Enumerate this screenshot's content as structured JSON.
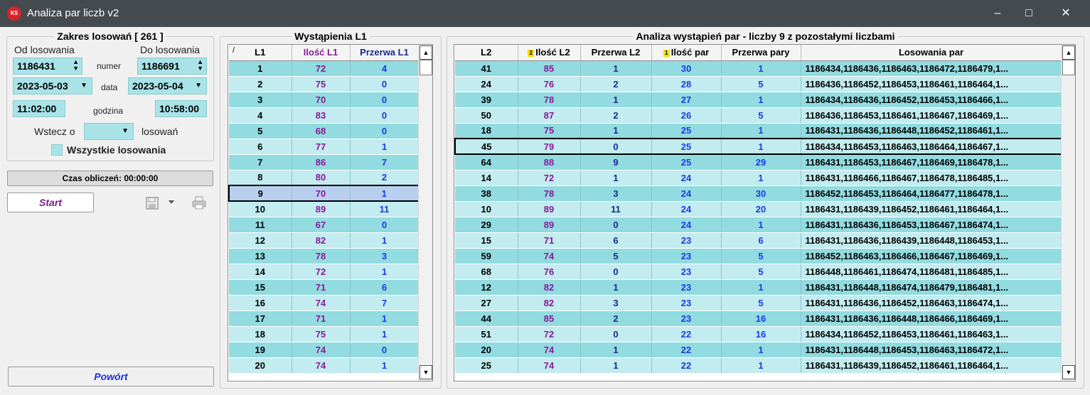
{
  "window": {
    "title": "Analiza par liczb v2",
    "app_icon": "K5"
  },
  "range": {
    "legend": "Zakres losowań  [ 261 ]",
    "from_label": "Od losowania",
    "to_label": "Do losowania",
    "from_number": "1186431",
    "to_number": "1186691",
    "number_label": "numer",
    "from_date": "2023-05-03",
    "to_date": "2023-05-04",
    "date_label": "data",
    "from_time": "11:02:00",
    "to_time": "10:58:00",
    "time_label": "godzina",
    "back_label": "Wstecz o",
    "back_value": "",
    "back_suffix": "losowań",
    "all_draws_label": "Wszystkie losowania"
  },
  "calc_time": "Czas obliczeń: 00:00:00",
  "start_label": "Start",
  "back_button": "Powórt",
  "l1": {
    "legend": "Wystąpienia L1",
    "headers": [
      "/",
      "L1",
      "Ilość L1",
      "Przerwa L1"
    ],
    "selected_index": 8,
    "rows": [
      [
        "1",
        "72",
        "4"
      ],
      [
        "2",
        "75",
        "0"
      ],
      [
        "3",
        "70",
        "0"
      ],
      [
        "4",
        "83",
        "0"
      ],
      [
        "5",
        "68",
        "0"
      ],
      [
        "6",
        "77",
        "1"
      ],
      [
        "7",
        "86",
        "7"
      ],
      [
        "8",
        "80",
        "2"
      ],
      [
        "9",
        "70",
        "1"
      ],
      [
        "10",
        "89",
        "11"
      ],
      [
        "11",
        "67",
        "0"
      ],
      [
        "12",
        "82",
        "1"
      ],
      [
        "13",
        "78",
        "3"
      ],
      [
        "14",
        "72",
        "1"
      ],
      [
        "15",
        "71",
        "6"
      ],
      [
        "16",
        "74",
        "7"
      ],
      [
        "17",
        "71",
        "1"
      ],
      [
        "18",
        "75",
        "1"
      ],
      [
        "19",
        "74",
        "0"
      ],
      [
        "20",
        "74",
        "1"
      ]
    ]
  },
  "pairs": {
    "legend": "Analiza wystąpień par - liczby 9 z pozostałymi liczbami",
    "headers": [
      "L2",
      "Ilość L2",
      "Przerwa L2",
      "Ilość par",
      "Przerwa pary",
      "Losowania par"
    ],
    "sort_badges": {
      "Ilość L2": "2",
      "Ilość par": "1"
    },
    "selected_index": 5,
    "rows": [
      [
        "41",
        "85",
        "1",
        "30",
        "1",
        "1186434,1186436,1186463,1186472,1186479,1..."
      ],
      [
        "24",
        "76",
        "2",
        "28",
        "5",
        "1186436,1186452,1186453,1186461,1186464,1..."
      ],
      [
        "39",
        "78",
        "1",
        "27",
        "1",
        "1186434,1186436,1186452,1186453,1186466,1..."
      ],
      [
        "50",
        "87",
        "2",
        "26",
        "5",
        "1186436,1186453,1186461,1186467,1186469,1..."
      ],
      [
        "18",
        "75",
        "1",
        "25",
        "1",
        "1186431,1186436,1186448,1186452,1186461,1..."
      ],
      [
        "45",
        "79",
        "0",
        "25",
        "1",
        "1186434,1186453,1186463,1186464,1186467,1..."
      ],
      [
        "64",
        "88",
        "9",
        "25",
        "29",
        "1186431,1186453,1186467,1186469,1186478,1..."
      ],
      [
        "14",
        "72",
        "1",
        "24",
        "1",
        "1186431,1186466,1186467,1186478,1186485,1..."
      ],
      [
        "38",
        "78",
        "3",
        "24",
        "30",
        "1186452,1186453,1186464,1186477,1186478,1..."
      ],
      [
        "10",
        "89",
        "11",
        "24",
        "20",
        "1186431,1186439,1186452,1186461,1186464,1..."
      ],
      [
        "29",
        "89",
        "0",
        "24",
        "1",
        "1186431,1186436,1186453,1186467,1186474,1..."
      ],
      [
        "15",
        "71",
        "6",
        "23",
        "6",
        "1186431,1186436,1186439,1186448,1186453,1..."
      ],
      [
        "59",
        "74",
        "5",
        "23",
        "5",
        "1186452,1186463,1186466,1186467,1186469,1..."
      ],
      [
        "68",
        "76",
        "0",
        "23",
        "5",
        "1186448,1186461,1186474,1186481,1186485,1..."
      ],
      [
        "12",
        "82",
        "1",
        "23",
        "1",
        "1186431,1186448,1186474,1186479,1186481,1..."
      ],
      [
        "27",
        "82",
        "3",
        "23",
        "5",
        "1186431,1186436,1186452,1186463,1186474,1..."
      ],
      [
        "44",
        "85",
        "2",
        "23",
        "16",
        "1186431,1186436,1186448,1186466,1186469,1..."
      ],
      [
        "51",
        "72",
        "0",
        "22",
        "16",
        "1186434,1186452,1186453,1186461,1186463,1..."
      ],
      [
        "20",
        "74",
        "1",
        "22",
        "1",
        "1186431,1186448,1186453,1186463,1186472,1..."
      ],
      [
        "25",
        "74",
        "1",
        "22",
        "1",
        "1186431,1186439,1186452,1186461,1186464,1..."
      ]
    ]
  },
  "colors": {
    "row_odd": "#92dbe0",
    "row_even": "#c2ecef",
    "purple": "#8a1a9a",
    "blue": "#1a3ce0"
  }
}
